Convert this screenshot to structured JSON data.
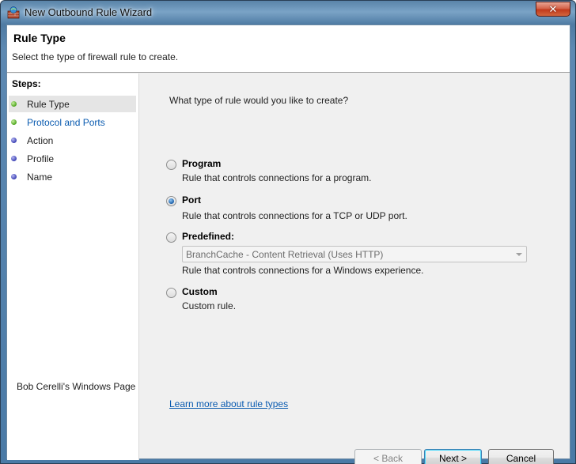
{
  "window": {
    "title": "New Outbound Rule Wizard",
    "close_label": "✕"
  },
  "header": {
    "title": "Rule Type",
    "subtitle": "Select the type of firewall rule to create."
  },
  "steps": {
    "label": "Steps:",
    "items": [
      {
        "label": "Rule Type",
        "status": "green"
      },
      {
        "label": "Protocol and Ports",
        "status": "green"
      },
      {
        "label": "Action",
        "status": "blue"
      },
      {
        "label": "Profile",
        "status": "blue"
      },
      {
        "label": "Name",
        "status": "blue"
      }
    ],
    "footer": "Bob Cerelli's Windows Page"
  },
  "main": {
    "question": "What type of rule would you like to create?",
    "options": [
      {
        "label": "Program",
        "description": "Rule that controls connections for a program.",
        "checked": false
      },
      {
        "label": "Port",
        "description": "Rule that controls connections for a TCP or UDP port.",
        "checked": true
      },
      {
        "label": "Predefined:",
        "description": "Rule that controls connections for a Windows experience.",
        "checked": false
      },
      {
        "label": "Custom",
        "description": "Custom rule.",
        "checked": false
      }
    ],
    "predefined_value": "BranchCache - Content Retrieval (Uses HTTP)",
    "learn_more": "Learn more about rule types"
  },
  "buttons": {
    "back": "< Back",
    "next": "Next >",
    "cancel": "Cancel"
  },
  "colors": {
    "accent_link": "#0a5bb0",
    "step_done": "#4ea51f",
    "step_pending": "#3a3fb3"
  }
}
